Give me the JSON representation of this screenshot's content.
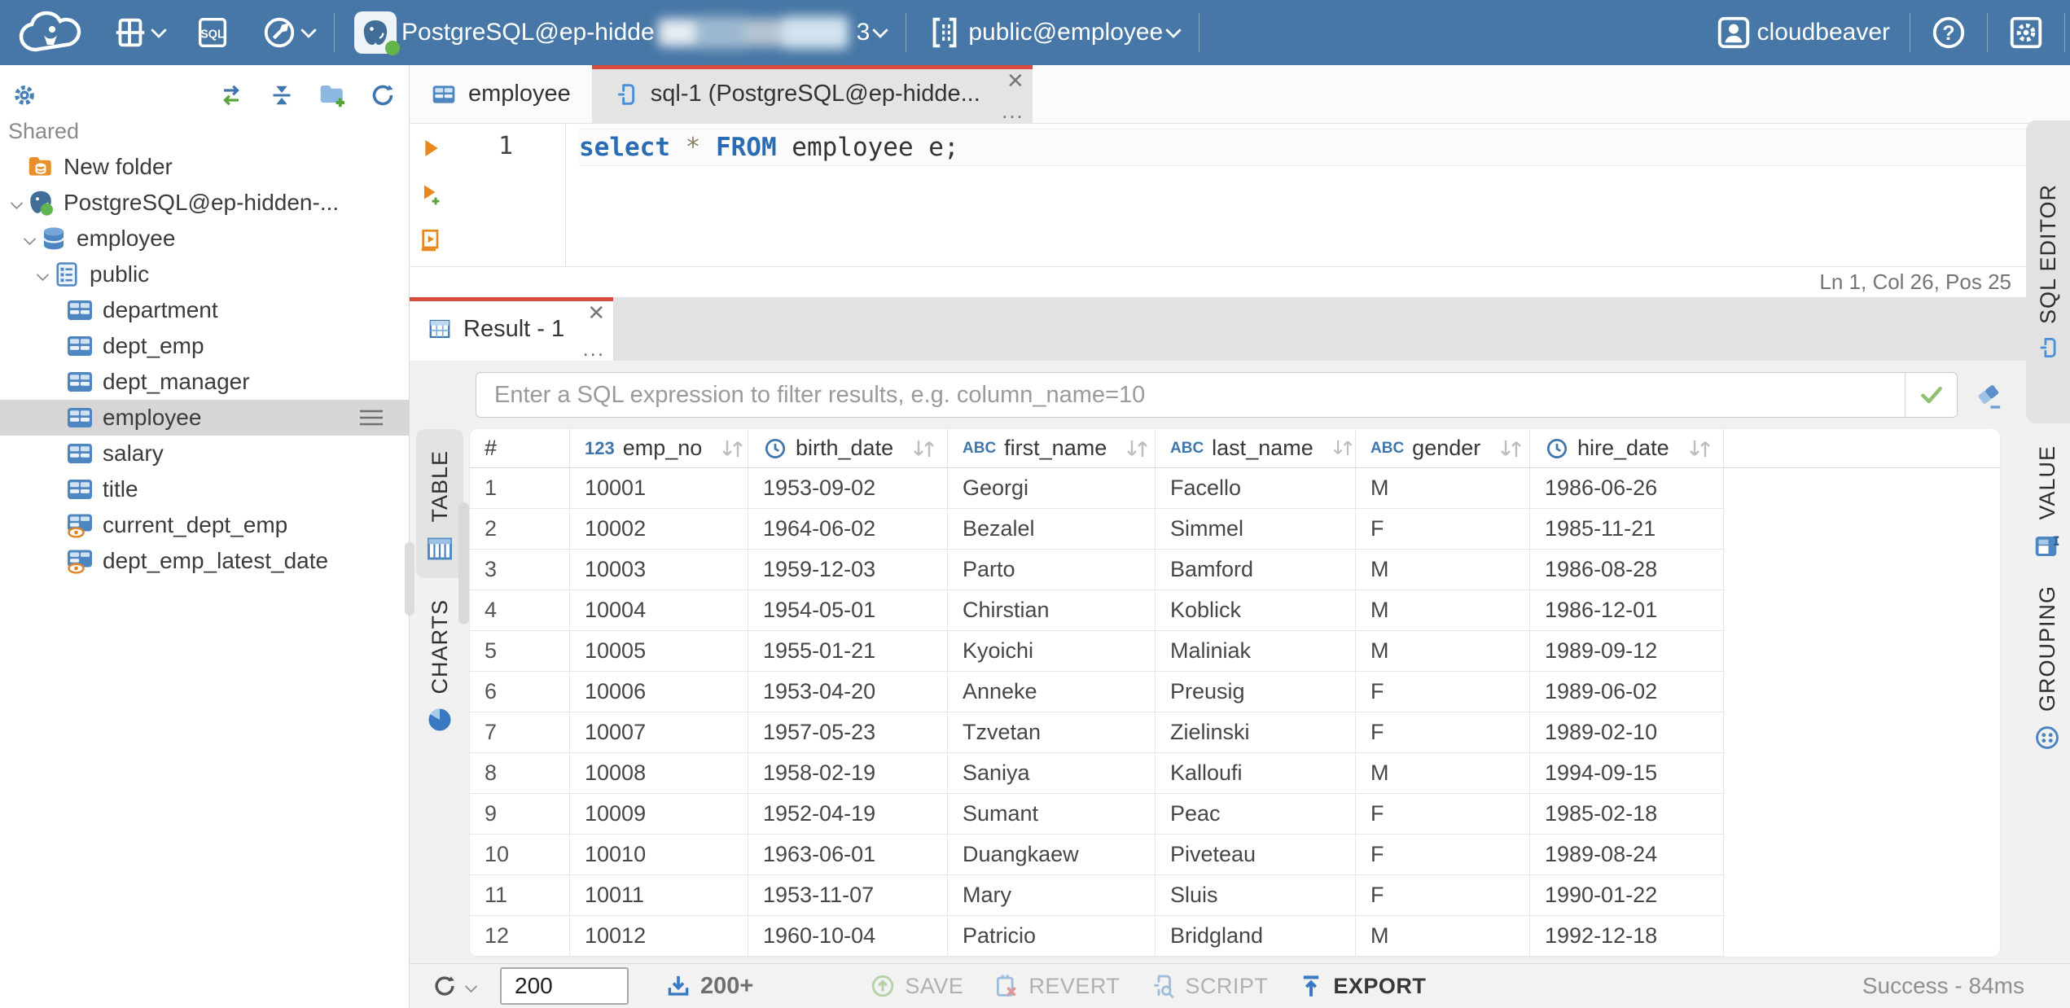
{
  "topbar": {
    "sql_button_label": "SQL",
    "connection": {
      "prefix": "PostgreSQL@ep-hidde",
      "suffix": "3"
    },
    "schema_label": "public@employee",
    "user_name": "cloudbeaver"
  },
  "sidebar": {
    "section_label": "Shared",
    "tree": [
      {
        "label": "New folder",
        "icon": "folder-db-icon",
        "level": 0,
        "chevron": false
      },
      {
        "label": "PostgreSQL@ep-hidden-...",
        "icon": "postgres-icon",
        "level": 0,
        "chevron": true
      },
      {
        "label": "employee",
        "icon": "database-icon",
        "level": 1,
        "chevron": true
      },
      {
        "label": "public",
        "icon": "schema-icon",
        "level": 2,
        "chevron": true
      },
      {
        "label": "department",
        "icon": "table-icon",
        "level": 3,
        "chevron": false
      },
      {
        "label": "dept_emp",
        "icon": "table-icon",
        "level": 3,
        "chevron": false
      },
      {
        "label": "dept_manager",
        "icon": "table-icon",
        "level": 3,
        "chevron": false
      },
      {
        "label": "employee",
        "icon": "table-icon",
        "level": 3,
        "chevron": false,
        "selected": true
      },
      {
        "label": "salary",
        "icon": "table-icon",
        "level": 3,
        "chevron": false
      },
      {
        "label": "title",
        "icon": "table-icon",
        "level": 3,
        "chevron": false
      },
      {
        "label": "current_dept_emp",
        "icon": "view-icon",
        "level": 3,
        "chevron": false
      },
      {
        "label": "dept_emp_latest_date",
        "icon": "view-icon",
        "level": 3,
        "chevron": false
      }
    ]
  },
  "editor": {
    "tabs": [
      {
        "label": "employee"
      },
      {
        "label": "sql-1 (PostgreSQL@ep-hidde..."
      }
    ],
    "line_number": "1",
    "sql": {
      "kw1": "select",
      "star": " * ",
      "kw2": "FROM",
      "rest": " employee e;"
    },
    "status": "Ln 1, Col 26, Pos 25",
    "side_tab": "SQL EDITOR"
  },
  "results": {
    "tab_label": "Result - 1",
    "filter_placeholder": "Enter a SQL expression to filter results, e.g. column_name=10",
    "left_tabs": [
      {
        "label": "TABLE"
      },
      {
        "label": "CHARTS"
      }
    ],
    "right_tabs": [
      {
        "label": "VALUE"
      },
      {
        "label": "GROUPING"
      }
    ],
    "grid": {
      "row_header": "#",
      "columns": [
        {
          "name": "emp_no",
          "type": "number"
        },
        {
          "name": "birth_date",
          "type": "date"
        },
        {
          "name": "first_name",
          "type": "text"
        },
        {
          "name": "last_name",
          "type": "text"
        },
        {
          "name": "gender",
          "type": "text"
        },
        {
          "name": "hire_date",
          "type": "date"
        }
      ],
      "rows": [
        [
          "1",
          "10001",
          "1953-09-02",
          "Georgi",
          "Facello",
          "M",
          "1986-06-26"
        ],
        [
          "2",
          "10002",
          "1964-06-02",
          "Bezalel",
          "Simmel",
          "F",
          "1985-11-21"
        ],
        [
          "3",
          "10003",
          "1959-12-03",
          "Parto",
          "Bamford",
          "M",
          "1986-08-28"
        ],
        [
          "4",
          "10004",
          "1954-05-01",
          "Chirstian",
          "Koblick",
          "M",
          "1986-12-01"
        ],
        [
          "5",
          "10005",
          "1955-01-21",
          "Kyoichi",
          "Maliniak",
          "M",
          "1989-09-12"
        ],
        [
          "6",
          "10006",
          "1953-04-20",
          "Anneke",
          "Preusig",
          "F",
          "1989-06-02"
        ],
        [
          "7",
          "10007",
          "1957-05-23",
          "Tzvetan",
          "Zielinski",
          "F",
          "1989-02-10"
        ],
        [
          "8",
          "10008",
          "1958-02-19",
          "Saniya",
          "Kalloufi",
          "M",
          "1994-09-15"
        ],
        [
          "9",
          "10009",
          "1952-04-19",
          "Sumant",
          "Peac",
          "F",
          "1985-02-18"
        ],
        [
          "10",
          "10010",
          "1963-06-01",
          "Duangkaew",
          "Piveteau",
          "F",
          "1989-08-24"
        ],
        [
          "11",
          "10011",
          "1953-11-07",
          "Mary",
          "Sluis",
          "F",
          "1990-01-22"
        ],
        [
          "12",
          "10012",
          "1960-10-04",
          "Patricio",
          "Bridgland",
          "M",
          "1992-12-18"
        ]
      ]
    },
    "toolbar": {
      "row_limit": "200",
      "fetch_label": "200+",
      "save_label": "SAVE",
      "revert_label": "REVERT",
      "script_label": "SCRIPT",
      "export_label": "EXPORT",
      "status": "Success - 84ms"
    }
  },
  "colors": {
    "topbar_blue": "#4677a6",
    "accent_red": "#d84b40",
    "icon_blue": "#3f76ad",
    "selection_gray": "#d6d6d6",
    "success_green": "#8fc172",
    "orange": "#e8871e"
  }
}
